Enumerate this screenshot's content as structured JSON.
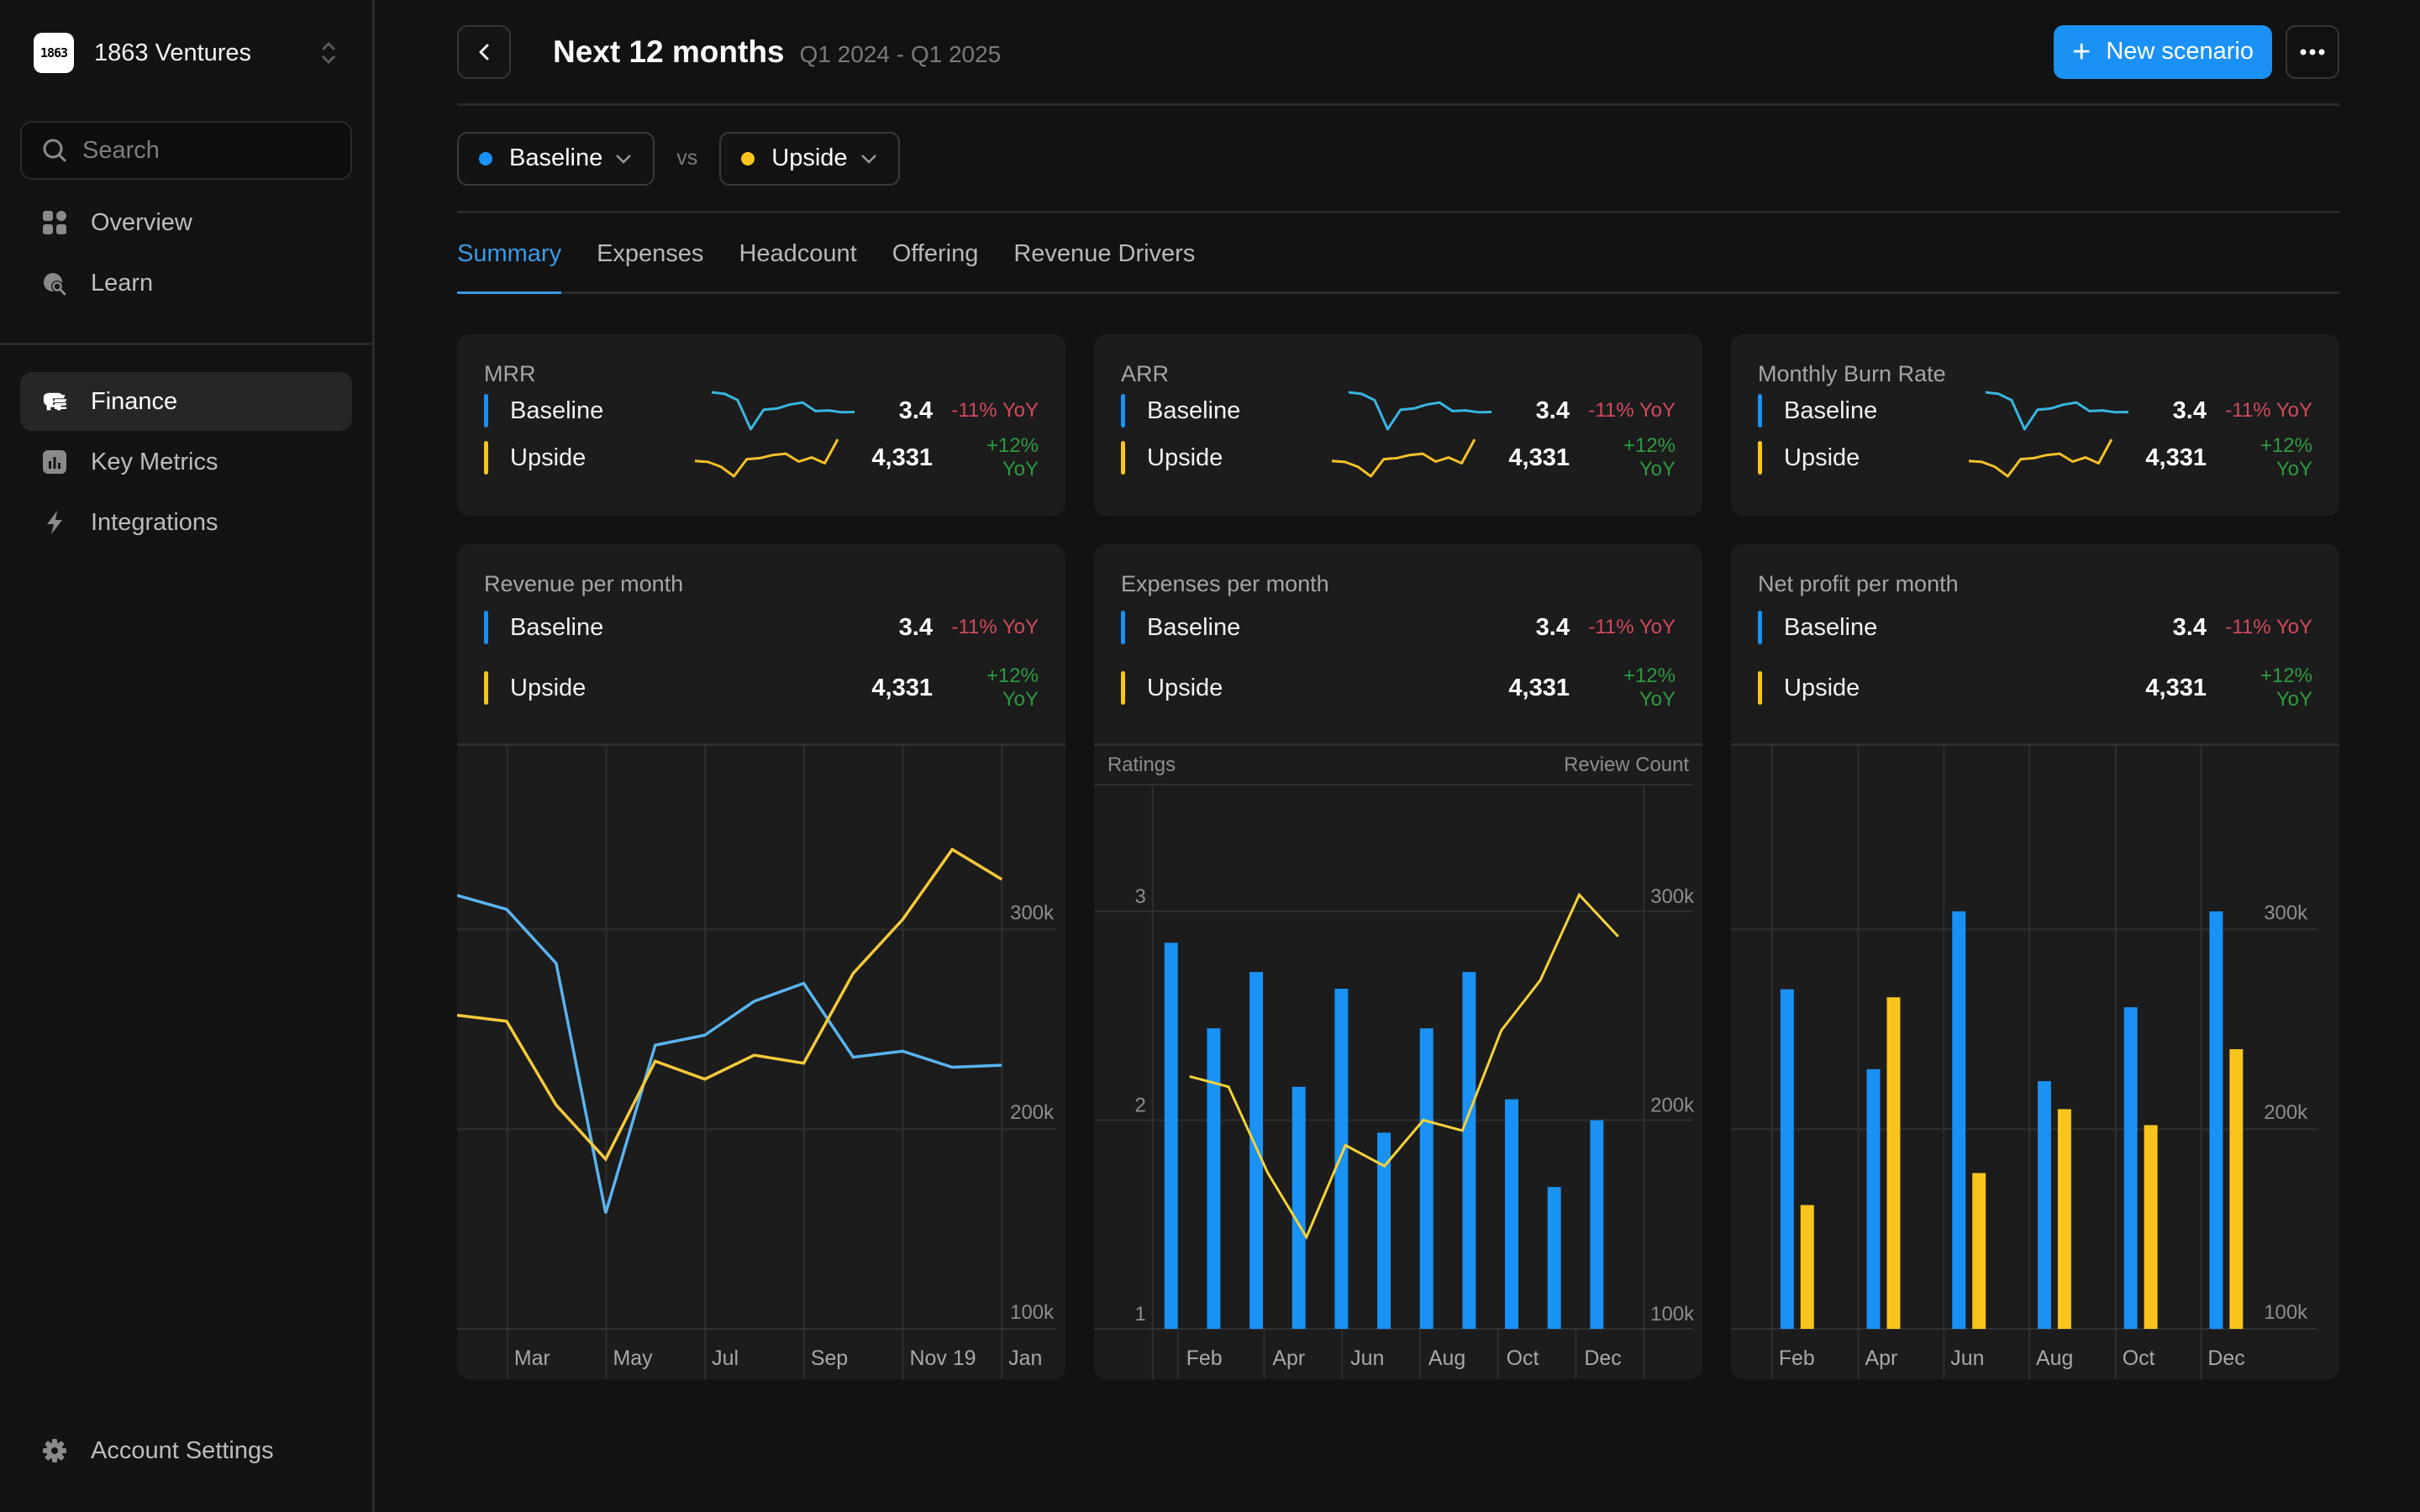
{
  "sidebar": {
    "brand": {
      "name": "1863 Ventures",
      "logo_text": "1863"
    },
    "search": {
      "placeholder": "Search",
      "value": ""
    },
    "group1": [
      {
        "label": "Overview",
        "icon": "grid-icon"
      },
      {
        "label": "Learn",
        "icon": "globe-search-icon"
      }
    ],
    "group2": [
      {
        "label": "Finance",
        "icon": "piggy-bank-icon",
        "active": true
      },
      {
        "label": "Key Metrics",
        "icon": "bar-chart-icon"
      },
      {
        "label": "Integrations",
        "icon": "lightning-icon"
      }
    ],
    "bottom": {
      "label": "Account Settings",
      "icon": "gear-icon"
    }
  },
  "header": {
    "title": "Next 12 months",
    "range": "Q1 2024 - Q1 2025",
    "new_button": "New scenario"
  },
  "scenarios": {
    "left": {
      "label": "Baseline",
      "color": "#1a91f5"
    },
    "vs": "vs",
    "right": {
      "label": "Upside",
      "color": "#f9c51c"
    }
  },
  "tabs": [
    {
      "label": "Summary",
      "active": true
    },
    {
      "label": "Expenses"
    },
    {
      "label": "Headcount"
    },
    {
      "label": "Offering"
    },
    {
      "label": "Revenue Drivers"
    }
  ],
  "colors": {
    "baseline": "#1a91f5",
    "upside": "#f9c51c",
    "spark_baseline": "#38b6e0",
    "spark_upside": "#f5c12a",
    "line_baseline": "#5ab4f0",
    "line_upside": "#f5c93a",
    "negative": "#d24a5c",
    "positive": "#2e9b3f"
  },
  "kpis": [
    {
      "title": "MRR",
      "rows": [
        {
          "label": "Baseline",
          "value": "3.4",
          "change": "-11% YoY",
          "trend": "neg",
          "spark": [
            317,
            310,
            283,
            158,
            242,
            247,
            264,
            273,
            236,
            239,
            231,
            232
          ]
        },
        {
          "label": "Upside",
          "value": "4,331",
          "change": "+12% YoY",
          "trend": "pos",
          "spark": [
            257,
            254,
            240,
            212,
            262,
            265,
            274,
            278,
            255,
            267,
            250,
            320
          ]
        }
      ]
    },
    {
      "title": "ARR",
      "rows": [
        {
          "label": "Baseline",
          "value": "3.4",
          "change": "-11% YoY",
          "trend": "neg",
          "spark": [
            317,
            310,
            283,
            158,
            242,
            247,
            264,
            273,
            236,
            239,
            231,
            232
          ]
        },
        {
          "label": "Upside",
          "value": "4,331",
          "change": "+12% YoY",
          "trend": "pos",
          "spark": [
            257,
            254,
            240,
            212,
            262,
            265,
            274,
            278,
            255,
            267,
            250,
            320
          ]
        }
      ]
    },
    {
      "title": "Monthly Burn Rate",
      "rows": [
        {
          "label": "Baseline",
          "value": "3.4",
          "change": "-11% YoY",
          "trend": "neg",
          "spark": [
            317,
            310,
            283,
            158,
            242,
            247,
            264,
            273,
            236,
            239,
            231,
            232
          ]
        },
        {
          "label": "Upside",
          "value": "4,331",
          "change": "+12% YoY",
          "trend": "pos",
          "spark": [
            257,
            254,
            240,
            212,
            262,
            265,
            274,
            278,
            255,
            267,
            250,
            320
          ]
        }
      ]
    }
  ],
  "panels": [
    {
      "title": "Revenue per month",
      "rows": [
        {
          "label": "Baseline",
          "value": "3.4",
          "change": "-11% YoY",
          "trend": "neg"
        },
        {
          "label": "Upside",
          "value": "4,331",
          "change": "+12% YoY",
          "trend": "pos"
        }
      ]
    },
    {
      "title": "Expenses per month",
      "rows": [
        {
          "label": "Baseline",
          "value": "3.4",
          "change": "-11% YoY",
          "trend": "neg"
        },
        {
          "label": "Upside",
          "value": "4,331",
          "change": "+12% YoY",
          "trend": "pos"
        }
      ]
    },
    {
      "title": "Net profit per month",
      "rows": [
        {
          "label": "Baseline",
          "value": "3.4",
          "change": "-11% YoY",
          "trend": "neg"
        },
        {
          "label": "Upside",
          "value": "4,331",
          "change": "+12% YoY",
          "trend": "pos"
        }
      ]
    }
  ],
  "chart_data": [
    {
      "type": "line",
      "title": "Revenue per month",
      "x_ticks": [
        "Mar",
        "May",
        "Jul",
        "Sep",
        "Nov 19",
        "Jan"
      ],
      "y_ticks": [
        "100k",
        "200k",
        "300k"
      ],
      "y_tick_values": [
        100,
        200,
        300
      ],
      "ylim": [
        100,
        375
      ],
      "y_axis_side": "right",
      "grid": true,
      "series": [
        {
          "name": "Baseline",
          "values": [
            317,
            310,
            283,
            158,
            242,
            247,
            264,
            273,
            236,
            239,
            231,
            232
          ]
        },
        {
          "name": "Upside",
          "values": [
            257,
            254,
            212,
            185,
            234,
            225,
            237,
            233,
            278,
            305,
            340,
            325
          ]
        }
      ]
    },
    {
      "type": "bar+line",
      "title": "Expenses per month",
      "left_axis_label": "Ratings",
      "right_axis_label": "Review Count",
      "x_ticks": [
        "Feb",
        "Apr",
        "Jun",
        "Aug",
        "Oct",
        "Dec"
      ],
      "left_ticks": [
        "1",
        "2",
        "3"
      ],
      "left_tick_values": [
        1,
        2,
        3
      ],
      "left_lim": [
        1,
        3.6
      ],
      "right_ticks": [
        "100k",
        "200k",
        "300k"
      ],
      "right_tick_values": [
        100,
        200,
        300
      ],
      "right_lim": [
        100,
        360
      ],
      "grid": true,
      "bars": {
        "name": "Ratings",
        "values": [
          2.85,
          2.44,
          2.71,
          2.16,
          2.63,
          1.94,
          2.44,
          2.71,
          2.1,
          1.68,
          2.0
        ]
      },
      "line": {
        "name": "Review Count",
        "values": [
          221,
          216,
          175,
          144,
          188,
          178,
          200,
          195,
          243,
          267,
          308,
          288
        ]
      }
    },
    {
      "type": "bar",
      "title": "Net profit per month",
      "categories": [
        "Feb",
        "Apr",
        "Jun",
        "Aug",
        "Oct",
        "Dec"
      ],
      "y_ticks": [
        "100k",
        "200k",
        "300k"
      ],
      "y_tick_values": [
        100,
        200,
        300
      ],
      "ylim": [
        100,
        375
      ],
      "y_axis_side": "right",
      "grid": true,
      "series": [
        {
          "name": "Baseline",
          "values": [
            270,
            230,
            309,
            224,
            261,
            309
          ]
        },
        {
          "name": "Upside",
          "values": [
            162,
            266,
            178,
            210,
            202,
            240
          ]
        }
      ]
    }
  ]
}
